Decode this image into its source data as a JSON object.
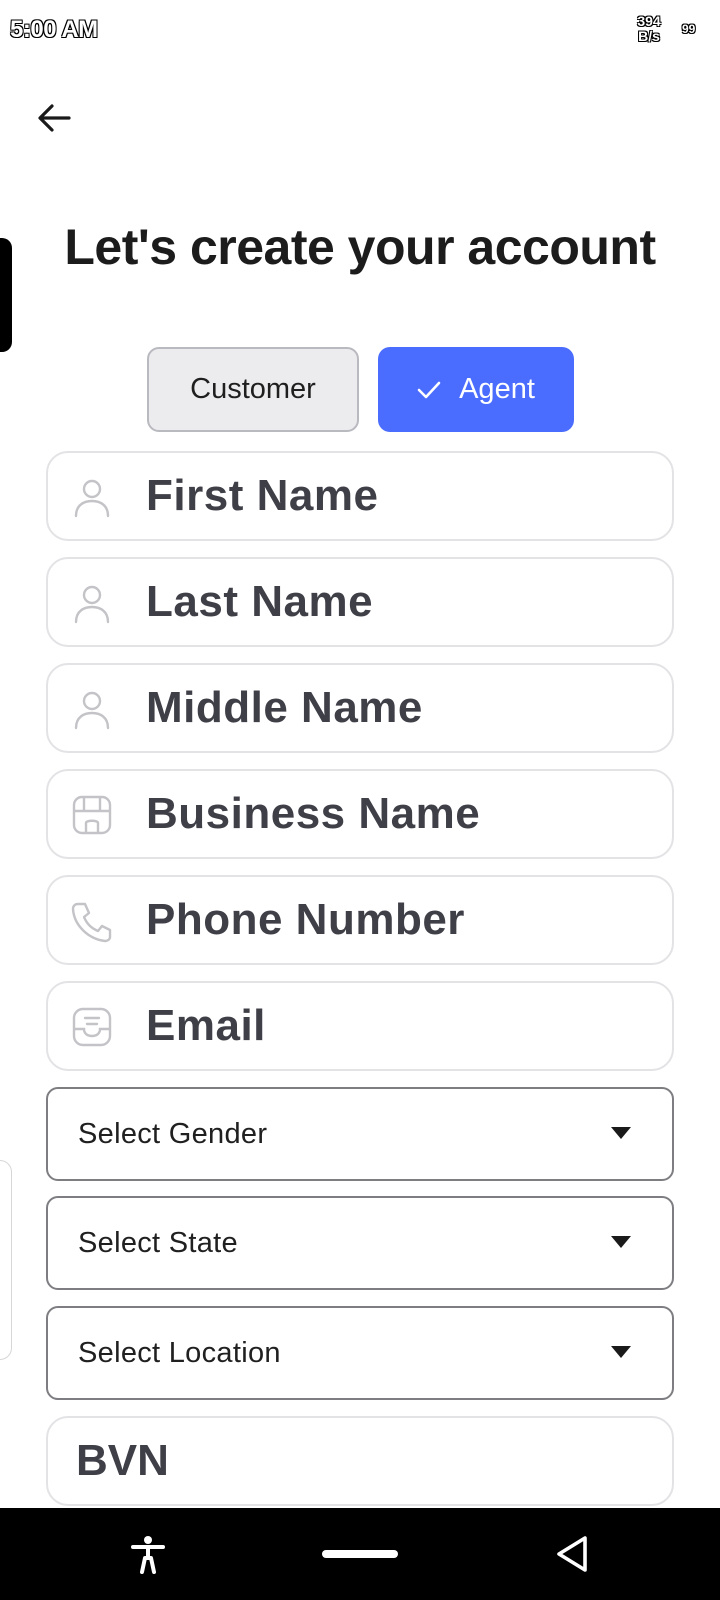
{
  "status_bar": {
    "time": "5:00 AM",
    "net_speed_value": "394",
    "net_speed_unit": "B/s",
    "battery": "99"
  },
  "page": {
    "title": "Let's create your account"
  },
  "role_toggle": {
    "options": [
      {
        "label": "Customer",
        "selected": false
      },
      {
        "label": "Agent",
        "selected": true
      }
    ],
    "accent_color": "#4a6cff"
  },
  "fields": {
    "first_name": {
      "placeholder": "First Name",
      "icon": "person-icon"
    },
    "last_name": {
      "placeholder": "Last Name",
      "icon": "person-icon"
    },
    "middle_name": {
      "placeholder": "Middle Name",
      "icon": "person-icon"
    },
    "business_name": {
      "placeholder": "Business Name",
      "icon": "store-icon"
    },
    "phone_number": {
      "placeholder": "Phone Number",
      "icon": "phone-icon"
    },
    "email": {
      "placeholder": "Email",
      "icon": "inbox-icon"
    },
    "bvn": {
      "placeholder": "BVN"
    }
  },
  "selects": {
    "gender": {
      "placeholder": "Select Gender"
    },
    "state": {
      "placeholder": "Select State"
    },
    "location": {
      "placeholder": "Select Location"
    }
  }
}
